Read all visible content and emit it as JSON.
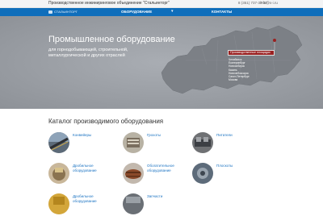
{
  "topbar": {
    "title": "Производственное инжиниринговое объединение \"Стальинторг\"",
    "phone": "8 (351) 737-37-37",
    "email": "info@s-i.ru"
  },
  "navbar": {
    "logo_text": "СТАЛЬИНТОРГ",
    "items": [
      {
        "label": "ОБОРУДОВАНИЕ"
      },
      {
        "label": "КОНТАКТЫ"
      }
    ]
  },
  "hero": {
    "title": "Промышленное оборудование",
    "subtitle_lines": [
      "для горнодобывающей, строительной,",
      "металлургической и других отраслей"
    ],
    "platforms_label": "Производственные площадки",
    "platforms": [
      "Челябинск",
      "Екатеринбург",
      "Новосибирск",
      "Казань",
      "Новочебоксарск",
      "Санкт-Петербург",
      "Москва"
    ]
  },
  "catalog": {
    "title": "Каталог производимого оборудования",
    "items": [
      {
        "label_lines": [
          "Конвейеры"
        ]
      },
      {
        "label_lines": [
          "Грохоты"
        ]
      },
      {
        "label_lines": [
          "Питатели"
        ]
      },
      {
        "label_lines": [
          "Дробильное",
          "оборудование"
        ]
      },
      {
        "label_lines": [
          "Обогатительное",
          "оборудование"
        ]
      },
      {
        "label_lines": [
          "Плоскоты"
        ]
      },
      {
        "label_lines": [
          "Дробильное",
          "оборудование"
        ]
      },
      {
        "label_lines": [
          "Запчасти"
        ]
      }
    ]
  },
  "colors": {
    "nav_blue": "#0f6ebb",
    "link_blue": "#1b73c2",
    "badge_red": "#9a2121",
    "hero_gray": "#9b9fa5"
  }
}
